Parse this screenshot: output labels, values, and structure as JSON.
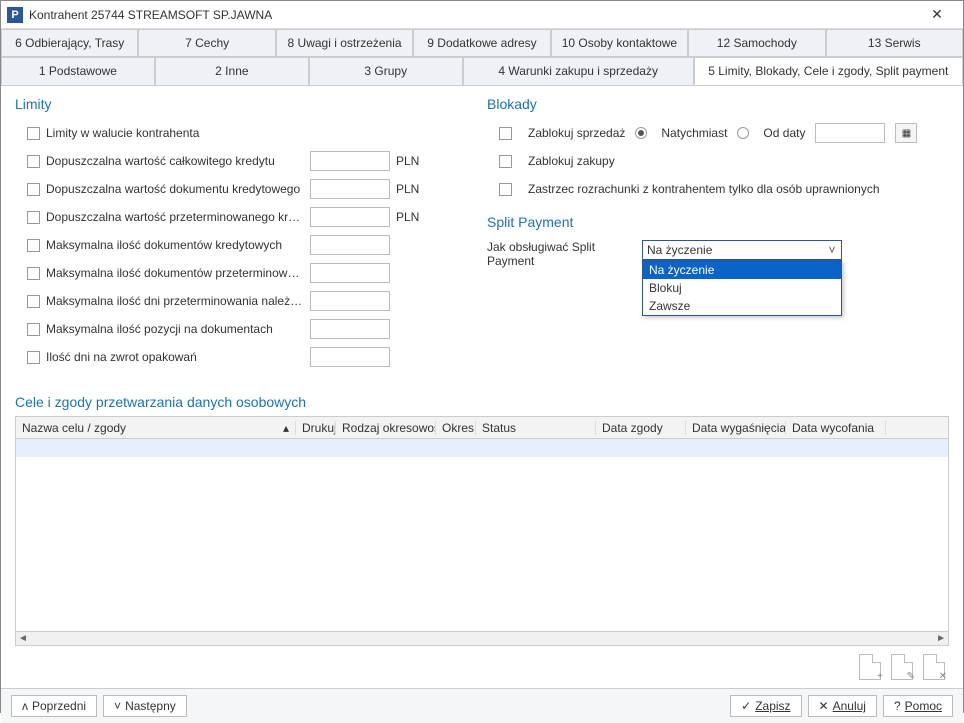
{
  "window": {
    "title": "Kontrahent  25744  STREAMSOFT SP.JAWNA",
    "icon_label": "P"
  },
  "tabs": {
    "row1": [
      "6 Odbierający, Trasy",
      "7 Cechy",
      "8 Uwagi i ostrzeżenia",
      "9 Dodatkowe adresy",
      "10 Osoby kontaktowe",
      "12 Samochody",
      "13 Serwis"
    ],
    "row2": [
      "1 Podstawowe",
      "2 Inne",
      "3 Grupy",
      "4 Warunki zakupu i sprzedaży",
      "5 Limity, Blokady, Cele i zgody, Split payment"
    ],
    "active": "5 Limity, Blokady, Cele i zgody, Split payment"
  },
  "limity": {
    "title": "Limity",
    "items": [
      {
        "label": "Limity w walucie kontrahenta",
        "has_input": false,
        "unit": ""
      },
      {
        "label": "Dopuszczalna wartość całkowitego kredytu",
        "has_input": true,
        "unit": "PLN"
      },
      {
        "label": "Dopuszczalna wartość dokumentu kredytowego",
        "has_input": true,
        "unit": "PLN"
      },
      {
        "label": "Dopuszczalna wartość przeterminowanego kredytu",
        "has_input": true,
        "unit": "PLN"
      },
      {
        "label": "Maksymalna ilość dokumentów kredytowych",
        "has_input": true,
        "unit": ""
      },
      {
        "label": "Maksymalna ilość dokumentów przeterminowanych",
        "has_input": true,
        "unit": ""
      },
      {
        "label": "Maksymalna ilość dni przeterminowania należności",
        "has_input": true,
        "unit": ""
      },
      {
        "label": "Maksymalna ilość pozycji na dokumentach",
        "has_input": true,
        "unit": ""
      },
      {
        "label": "Ilość dni na zwrot opakowań",
        "has_input": true,
        "unit": ""
      }
    ]
  },
  "blokady": {
    "title": "Blokady",
    "zablokuj_sprzedaz": "Zablokuj sprzedaż",
    "natychmiast": "Natychmiast",
    "od_daty": "Od daty",
    "zablokuj_zakupy": "Zablokuj zakupy",
    "zastrzec": "Zastrzec rozrachunki z kontrahentem tylko dla osób uprawnionych"
  },
  "split_payment": {
    "title": "Split Payment",
    "label": "Jak obsługiwać Split Payment",
    "value": "Na życzenie",
    "options": [
      "Na życzenie",
      "Blokuj",
      "Zawsze"
    ]
  },
  "cele": {
    "title": "Cele i zgody przetwarzania danych osobowych",
    "columns": [
      "Nazwa celu / zgody",
      "Drukuj",
      "Rodzaj okresowości",
      "Okres",
      "Status",
      "Data zgody",
      "Data wygaśnięcia",
      "Data wycofania"
    ]
  },
  "footer": {
    "poprzedni": "Poprzedni",
    "nastepny": "Następny",
    "zapisz": "Zapisz",
    "anuluj": "Anuluj",
    "pomoc": "Pomoc"
  }
}
